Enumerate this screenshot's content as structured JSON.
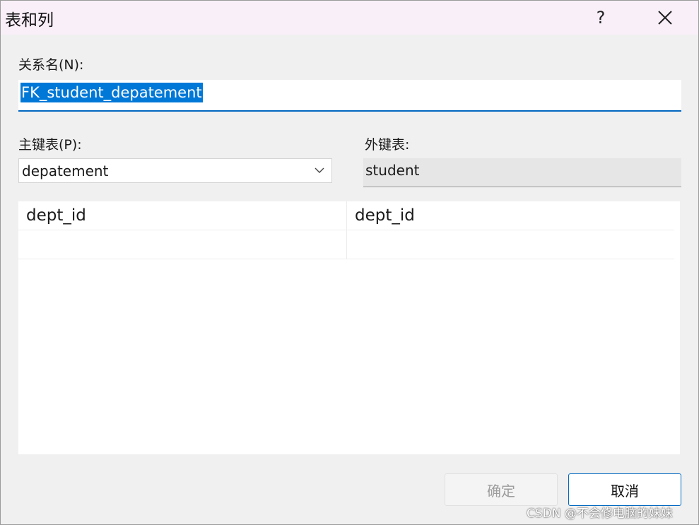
{
  "window": {
    "title": "表和列",
    "help_label": "?",
    "close_icon": "close-icon"
  },
  "relationship": {
    "label": "关系名(N):",
    "value": "FK_student_depatement"
  },
  "primary_table": {
    "label": "主键表(P):",
    "selected": "depatement",
    "dropdown_icon": "chevron-down-icon"
  },
  "foreign_table": {
    "label": "外键表:",
    "value": "student"
  },
  "columns_grid": {
    "rows": [
      [
        "dept_id",
        "dept_id"
      ],
      [
        "",
        ""
      ]
    ]
  },
  "buttons": {
    "ok_label": "确定",
    "cancel_label": "取消"
  },
  "watermark": "CSDN @不会修电脑的妹妹",
  "colors": {
    "selection": "#0078d7",
    "focus_border": "#0067c0",
    "titlebar": "#f8eff8",
    "dialog_bg": "#f0f0f0"
  }
}
